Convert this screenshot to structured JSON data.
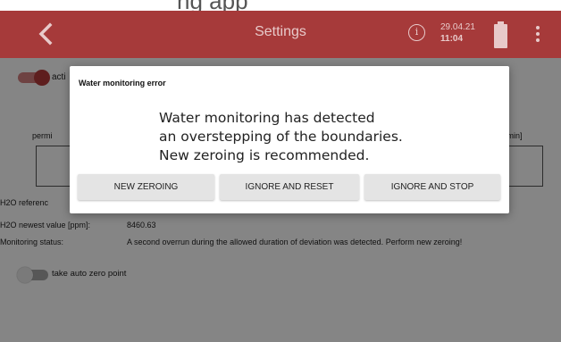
{
  "top_strip": {
    "partial_text": "ng app"
  },
  "header": {
    "title": "Settings",
    "info_symbol": "i",
    "date": "29.04.21",
    "time": "11:04",
    "icons": [
      "back-chevron-icon",
      "info-icon",
      "battery-icon",
      "more-vert-icon"
    ]
  },
  "settings": {
    "active_toggle": {
      "label": "acti",
      "state": "on"
    },
    "perm_label": "permi",
    "min_label": "[min]",
    "h2o_reference_label": "H2O referenc",
    "h2o_newest_label": "H2O newest value [ppm]:",
    "h2o_newest_value": "8460.63",
    "monitoring_status_label": "Monitoring status:",
    "monitoring_status_value": "A second overrun during the allowed duration of deviation was detected. Perform new zeroing!",
    "auto_zero_toggle": {
      "label": "take auto zero point",
      "state": "off"
    }
  },
  "dialog": {
    "title": "Water monitoring error",
    "message_lines": [
      "Water monitoring has detected",
      "an overstepping of the boundaries.",
      "New zeroing is recommended."
    ],
    "buttons": {
      "new_zeroing": "NEW ZEROING",
      "ignore_reset": "IGNORE AND RESET",
      "ignore_stop": "IGNORE AND STOP"
    }
  },
  "colors": {
    "header_bg": "#a63a3a",
    "toggle_accent": "#b53b3b"
  }
}
